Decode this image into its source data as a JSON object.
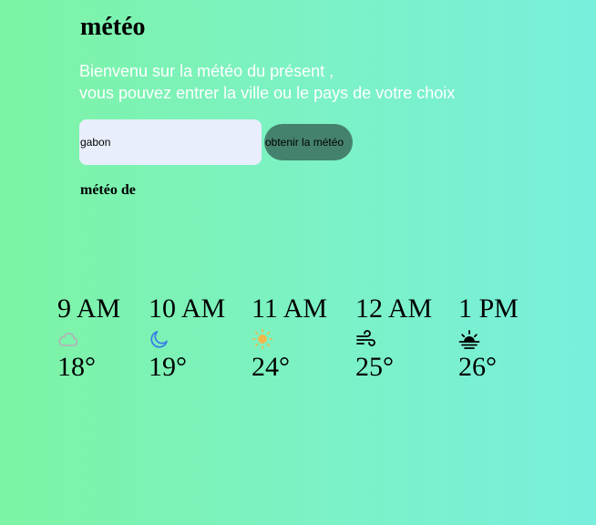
{
  "header": {
    "title": "météo",
    "intro_line1": "Bienvenu sur la météo du présent ,",
    "intro_line2": "vous pouvez entrer la ville ou le pays de votre choix"
  },
  "search": {
    "value": "gabon",
    "button_label": "obtenir la météo"
  },
  "result": {
    "label": "météo de"
  },
  "forecast": [
    {
      "time": "9 AM",
      "icon": "cloud-icon",
      "icon_color": "#b0b4b6",
      "temp": "18°"
    },
    {
      "time": "10 AM",
      "icon": "moon-icon",
      "icon_color": "#3a7de8",
      "temp": "19°"
    },
    {
      "time": "11 AM",
      "icon": "sun-icon",
      "icon_color": "#f2b84b",
      "temp": "24°"
    },
    {
      "time": "12 AM",
      "icon": "wind-icon",
      "icon_color": "#000000",
      "temp": "25°"
    },
    {
      "time": "1 PM",
      "icon": "sunrise-icon",
      "icon_color": "#000000",
      "temp": "26°"
    }
  ]
}
